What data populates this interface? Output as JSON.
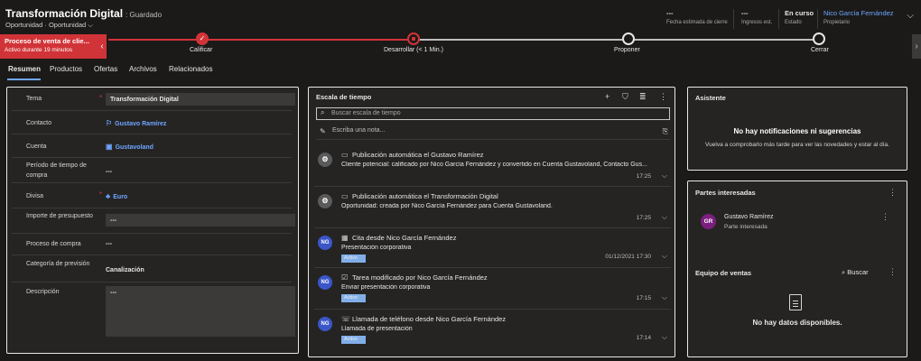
{
  "header": {
    "title": "Transformación Digital",
    "saved": ": Guardado",
    "subtitle": "Oportunidad · Oportunidad ⌵",
    "fields": [
      {
        "value": "---",
        "label": "Fecha estimada de cierre"
      },
      {
        "value": "---",
        "label": "Ingresos est."
      },
      {
        "value": "En curso",
        "label": "Estado"
      },
      {
        "value": "Nico García Fernández",
        "label": "Propietario"
      }
    ]
  },
  "bpf": {
    "name": "Proceso de venta de clie...",
    "duration": "Activo durante 19 minutos",
    "stages": [
      {
        "label": "Calificar",
        "state": "done"
      },
      {
        "label": "Desarrollar  (< 1 Min.)",
        "state": "active"
      },
      {
        "label": "Proponer",
        "state": "todo"
      },
      {
        "label": "Cerrar",
        "state": "todo"
      }
    ]
  },
  "tabs": [
    "Resumen",
    "Productos",
    "Ofertas",
    "Archivos",
    "Relacionados"
  ],
  "form": {
    "tema": {
      "label": "Tema",
      "value": "Transformación Digital"
    },
    "contacto": {
      "label": "Contacto",
      "value": "Gustavo Ramírez"
    },
    "cuenta": {
      "label": "Cuenta",
      "value": "Gustavoland"
    },
    "periodo": {
      "label": "Período de tiempo de compra",
      "value": "---"
    },
    "divisa": {
      "label": "Divisa",
      "value": "Euro"
    },
    "importe": {
      "label": "Importe de presupuesto",
      "value": "---"
    },
    "proceso": {
      "label": "Proceso de compra",
      "value": "---"
    },
    "categoria": {
      "label": "Categoría de previsión",
      "value": "Canalización"
    },
    "descripcion": {
      "label": "Descripción",
      "value": "---"
    }
  },
  "timeline": {
    "title": "Escala de tiempo",
    "search_placeholder": "Buscar escala de tiempo",
    "note_placeholder": "Escriba una nota...",
    "items": [
      {
        "avatar": "⚙",
        "header": "Publicación automática el Gustavo Ramírez",
        "body": "Cliente potencial: calificado por Nico García Fernández y convertido en Cuenta Gustavoland, Contacto Gus...",
        "time": "17:25",
        "badge": ""
      },
      {
        "avatar": "⚙",
        "header": "Publicación automática el Transformación Digital",
        "body": "Oportunidad: creada por Nico García Fernández para Cuenta Gustavoland.",
        "time": "17:25",
        "badge": ""
      },
      {
        "avatar": "NG",
        "header": "Cita desde Nico García Fernández",
        "body": "Presentación corporativa",
        "time": "01/12/2021 17:30",
        "badge": "Activo"
      },
      {
        "avatar": "NG",
        "header": "Tarea modificado por Nico García Fernández",
        "body": "Enviar presentación corporativa",
        "time": "17:15",
        "badge": "Activo"
      },
      {
        "avatar": "NG",
        "header": "Llamada de teléfono desde Nico García Fernández",
        "body": "Llamada de presentación",
        "time": "17:14",
        "badge": "Activo"
      }
    ]
  },
  "asistente": {
    "title": "Asistente",
    "msg_title": "No hay notificaciones ni sugerencias",
    "msg_sub": "Vuelva a comprobarlo más tarde para ver las novedades y estar al día."
  },
  "partes": {
    "title": "Partes interesadas",
    "contact": {
      "initials": "GR",
      "name": "Gustavo Ramírez",
      "role": "Parte interesada"
    },
    "equipo_title": "Equipo de ventas",
    "search_label": "Buscar",
    "empty": "No hay datos disponibles."
  },
  "colors": {
    "accent": "#d13438",
    "link": "#6ea6ff",
    "badge": "#82aee8"
  }
}
